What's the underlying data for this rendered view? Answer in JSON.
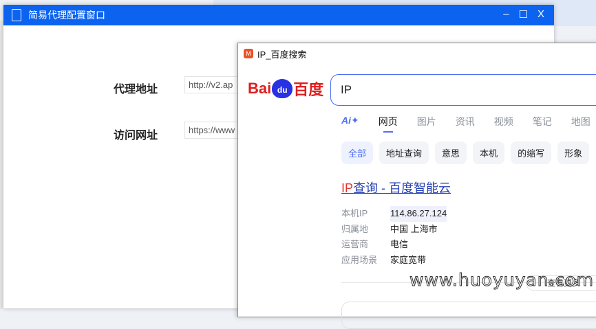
{
  "proxy_window": {
    "title": "简易代理配置窗口",
    "controls": {
      "minimize": "–",
      "maximize": "☐",
      "close": "X"
    },
    "fields": [
      {
        "label": "代理地址",
        "value": "http://v2.ap"
      },
      {
        "label": "访问网址",
        "value": "https://www"
      }
    ]
  },
  "browser": {
    "title": "IP_百度搜索",
    "logo": {
      "left": "Bai",
      "paw": "du",
      "right": "百度"
    },
    "search_value": "IP",
    "tabs": [
      "Ai✦",
      "网页",
      "图片",
      "资讯",
      "视频",
      "笔记",
      "地图"
    ],
    "chips": [
      "全部",
      "地址查询",
      "意思",
      "本机",
      "的缩写",
      "形象"
    ],
    "result": {
      "title_ip": "IP",
      "title_rest": "查询 - 百度智能云",
      "rows": [
        {
          "k": "本机IP",
          "v": "114.86.27.124"
        },
        {
          "k": "归属地",
          "v": "中国 上海市"
        },
        {
          "k": "运营商",
          "v": "电信"
        },
        {
          "k": "应用场景",
          "v": "家庭宽带"
        }
      ],
      "more": "查看更多"
    }
  },
  "watermark": "www.huoyuyan.com"
}
